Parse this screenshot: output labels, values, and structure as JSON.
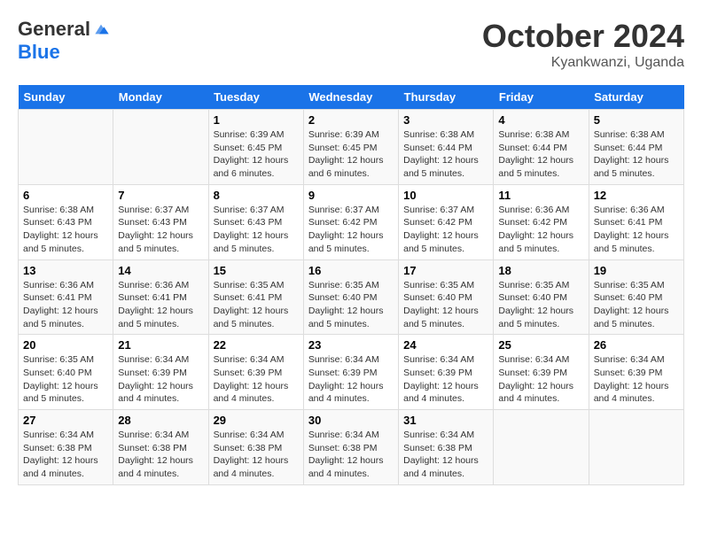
{
  "header": {
    "logo_general": "General",
    "logo_blue": "Blue",
    "month_title": "October 2024",
    "location": "Kyankwanzi, Uganda"
  },
  "days_of_week": [
    "Sunday",
    "Monday",
    "Tuesday",
    "Wednesday",
    "Thursday",
    "Friday",
    "Saturday"
  ],
  "weeks": [
    {
      "days": [
        {
          "number": "",
          "info": ""
        },
        {
          "number": "",
          "info": ""
        },
        {
          "number": "1",
          "info": "Sunrise: 6:39 AM\nSunset: 6:45 PM\nDaylight: 12 hours\nand 6 minutes."
        },
        {
          "number": "2",
          "info": "Sunrise: 6:39 AM\nSunset: 6:45 PM\nDaylight: 12 hours\nand 6 minutes."
        },
        {
          "number": "3",
          "info": "Sunrise: 6:38 AM\nSunset: 6:44 PM\nDaylight: 12 hours\nand 5 minutes."
        },
        {
          "number": "4",
          "info": "Sunrise: 6:38 AM\nSunset: 6:44 PM\nDaylight: 12 hours\nand 5 minutes."
        },
        {
          "number": "5",
          "info": "Sunrise: 6:38 AM\nSunset: 6:44 PM\nDaylight: 12 hours\nand 5 minutes."
        }
      ]
    },
    {
      "days": [
        {
          "number": "6",
          "info": "Sunrise: 6:38 AM\nSunset: 6:43 PM\nDaylight: 12 hours\nand 5 minutes."
        },
        {
          "number": "7",
          "info": "Sunrise: 6:37 AM\nSunset: 6:43 PM\nDaylight: 12 hours\nand 5 minutes."
        },
        {
          "number": "8",
          "info": "Sunrise: 6:37 AM\nSunset: 6:43 PM\nDaylight: 12 hours\nand 5 minutes."
        },
        {
          "number": "9",
          "info": "Sunrise: 6:37 AM\nSunset: 6:42 PM\nDaylight: 12 hours\nand 5 minutes."
        },
        {
          "number": "10",
          "info": "Sunrise: 6:37 AM\nSunset: 6:42 PM\nDaylight: 12 hours\nand 5 minutes."
        },
        {
          "number": "11",
          "info": "Sunrise: 6:36 AM\nSunset: 6:42 PM\nDaylight: 12 hours\nand 5 minutes."
        },
        {
          "number": "12",
          "info": "Sunrise: 6:36 AM\nSunset: 6:41 PM\nDaylight: 12 hours\nand 5 minutes."
        }
      ]
    },
    {
      "days": [
        {
          "number": "13",
          "info": "Sunrise: 6:36 AM\nSunset: 6:41 PM\nDaylight: 12 hours\nand 5 minutes."
        },
        {
          "number": "14",
          "info": "Sunrise: 6:36 AM\nSunset: 6:41 PM\nDaylight: 12 hours\nand 5 minutes."
        },
        {
          "number": "15",
          "info": "Sunrise: 6:35 AM\nSunset: 6:41 PM\nDaylight: 12 hours\nand 5 minutes."
        },
        {
          "number": "16",
          "info": "Sunrise: 6:35 AM\nSunset: 6:40 PM\nDaylight: 12 hours\nand 5 minutes."
        },
        {
          "number": "17",
          "info": "Sunrise: 6:35 AM\nSunset: 6:40 PM\nDaylight: 12 hours\nand 5 minutes."
        },
        {
          "number": "18",
          "info": "Sunrise: 6:35 AM\nSunset: 6:40 PM\nDaylight: 12 hours\nand 5 minutes."
        },
        {
          "number": "19",
          "info": "Sunrise: 6:35 AM\nSunset: 6:40 PM\nDaylight: 12 hours\nand 5 minutes."
        }
      ]
    },
    {
      "days": [
        {
          "number": "20",
          "info": "Sunrise: 6:35 AM\nSunset: 6:40 PM\nDaylight: 12 hours\nand 5 minutes."
        },
        {
          "number": "21",
          "info": "Sunrise: 6:34 AM\nSunset: 6:39 PM\nDaylight: 12 hours\nand 4 minutes."
        },
        {
          "number": "22",
          "info": "Sunrise: 6:34 AM\nSunset: 6:39 PM\nDaylight: 12 hours\nand 4 minutes."
        },
        {
          "number": "23",
          "info": "Sunrise: 6:34 AM\nSunset: 6:39 PM\nDaylight: 12 hours\nand 4 minutes."
        },
        {
          "number": "24",
          "info": "Sunrise: 6:34 AM\nSunset: 6:39 PM\nDaylight: 12 hours\nand 4 minutes."
        },
        {
          "number": "25",
          "info": "Sunrise: 6:34 AM\nSunset: 6:39 PM\nDaylight: 12 hours\nand 4 minutes."
        },
        {
          "number": "26",
          "info": "Sunrise: 6:34 AM\nSunset: 6:39 PM\nDaylight: 12 hours\nand 4 minutes."
        }
      ]
    },
    {
      "days": [
        {
          "number": "27",
          "info": "Sunrise: 6:34 AM\nSunset: 6:38 PM\nDaylight: 12 hours\nand 4 minutes."
        },
        {
          "number": "28",
          "info": "Sunrise: 6:34 AM\nSunset: 6:38 PM\nDaylight: 12 hours\nand 4 minutes."
        },
        {
          "number": "29",
          "info": "Sunrise: 6:34 AM\nSunset: 6:38 PM\nDaylight: 12 hours\nand 4 minutes."
        },
        {
          "number": "30",
          "info": "Sunrise: 6:34 AM\nSunset: 6:38 PM\nDaylight: 12 hours\nand 4 minutes."
        },
        {
          "number": "31",
          "info": "Sunrise: 6:34 AM\nSunset: 6:38 PM\nDaylight: 12 hours\nand 4 minutes."
        },
        {
          "number": "",
          "info": ""
        },
        {
          "number": "",
          "info": ""
        }
      ]
    }
  ]
}
